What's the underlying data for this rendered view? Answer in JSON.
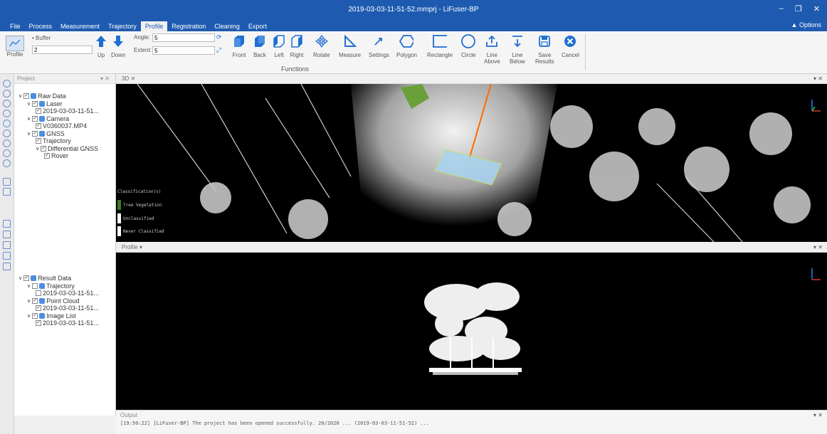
{
  "window": {
    "title": "2019-03-03-11-51-52.mmprj - LiFuser-BP",
    "minimize": "–",
    "restore": "❐",
    "close": "✕"
  },
  "menu": {
    "items": [
      "File",
      "Process",
      "Measurement",
      "Trajectory",
      "Profile",
      "Registration",
      "Cleaning",
      "Export"
    ],
    "active": "Profile",
    "options": "Options"
  },
  "ribbon": {
    "profile_label": "Profile",
    "buffer_label": "Buffer",
    "buffer_value": "2",
    "up": "Up",
    "down": "Down",
    "angle_label": "Angle:",
    "angle_value": "5",
    "extent_label": "Extent:",
    "extent_value": "5",
    "views": [
      "Front",
      "Back",
      "Left",
      "Right"
    ],
    "tools": [
      "Rotate",
      "Measure",
      "Settings",
      "Polygon",
      "Rectangle",
      "Circle"
    ],
    "line_above": [
      "Line",
      "Above"
    ],
    "line_below": [
      "Line",
      "Below"
    ],
    "save": [
      "Save",
      "Results"
    ],
    "cancel": "Cancel",
    "group": "Functions"
  },
  "project_panel": {
    "title": "Project",
    "raw_tree": [
      {
        "indent": 0,
        "label": "Raw Data",
        "icon": "database-icon",
        "checked": true
      },
      {
        "indent": 1,
        "label": "Laser",
        "icon": "laser-icon",
        "checked": true
      },
      {
        "indent": 2,
        "label": "2019-03-03-11-51...",
        "icon": "",
        "checked": true
      },
      {
        "indent": 1,
        "label": "Camera",
        "icon": "camera-icon",
        "checked": true
      },
      {
        "indent": 2,
        "label": "V0360037.MP4",
        "icon": "",
        "checked": true
      },
      {
        "indent": 1,
        "label": "GNSS",
        "icon": "gnss-icon",
        "checked": true
      },
      {
        "indent": 2,
        "label": "Trajectory",
        "icon": "",
        "checked": true
      },
      {
        "indent": 2,
        "label": "Differential GNSS",
        "icon": "",
        "checked": true
      },
      {
        "indent": 3,
        "label": "Rover",
        "icon": "",
        "checked": true
      }
    ],
    "result_tree": [
      {
        "indent": 0,
        "label": "Result Data",
        "icon": "database-icon",
        "checked": true
      },
      {
        "indent": 1,
        "label": "Trajectory",
        "icon": "trajectory-icon",
        "checked": false
      },
      {
        "indent": 2,
        "label": "2019-03-03-11-51...",
        "icon": "",
        "checked": false
      },
      {
        "indent": 1,
        "label": "Point Cloud",
        "icon": "pointcloud-icon",
        "checked": true
      },
      {
        "indent": 2,
        "label": "2019-03-03-11-51...",
        "icon": "",
        "checked": true
      },
      {
        "indent": 1,
        "label": "Image List",
        "icon": "image-icon",
        "checked": true
      },
      {
        "indent": 2,
        "label": "2019-03-03-11-51...",
        "icon": "",
        "checked": true
      }
    ]
  },
  "view3d": {
    "tab": "3D",
    "legend_title": "Classification(s)",
    "legend": [
      {
        "label": "Tree Vegetation",
        "color": "#3d7a2a"
      },
      {
        "label": "Unclassified",
        "color": "#ffffff"
      },
      {
        "label": "Never Classified",
        "color": "#ffffff"
      }
    ]
  },
  "profile_view": {
    "tab": "Profile"
  },
  "output": {
    "tab": "Output",
    "line": "[19:50:22] [LiFuser-BP] The project has been opened successfully. 20/2020 ... (2019-03-03-11-51-52) ..."
  },
  "colors": {
    "accent": "#1e5bb0",
    "selection": "#a8d4f0",
    "trajectory": "#ff6a00"
  }
}
